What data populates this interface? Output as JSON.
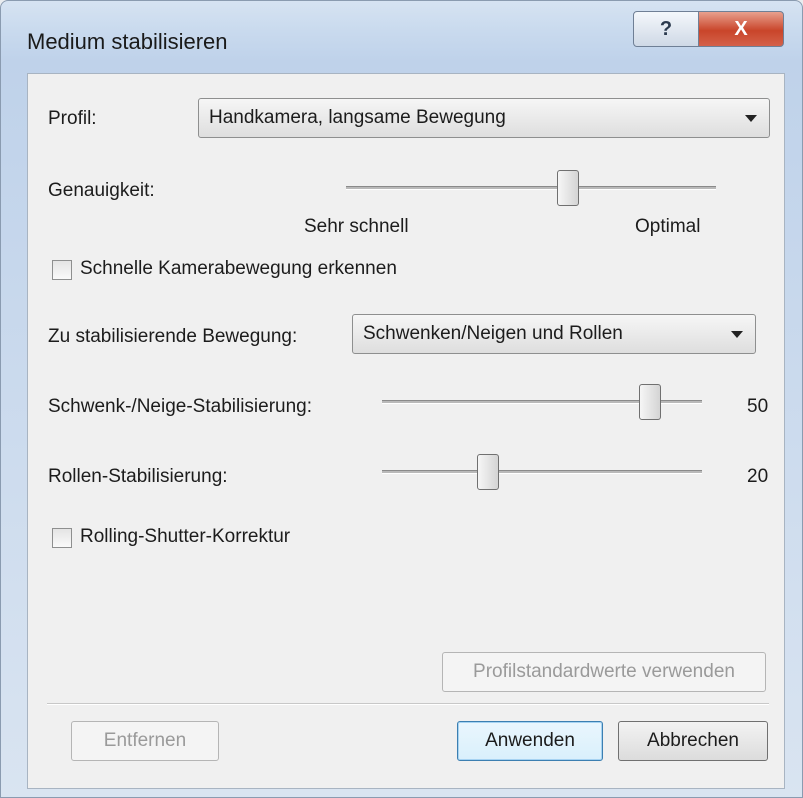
{
  "window": {
    "title": "Medium stabilisieren",
    "help_icon": "?",
    "close_icon": "X"
  },
  "profile": {
    "label": "Profil:",
    "value": "Handkamera, langsame Bewegung"
  },
  "accuracy": {
    "label": "Genauigkeit:",
    "min_label": "Sehr schnell",
    "max_label": "Optimal",
    "value_fraction": 0.6
  },
  "fast_camera": {
    "label": "Schnelle Kamerabewegung erkennen",
    "checked": false
  },
  "motion": {
    "label": "Zu stabilisierende Bewegung:",
    "value": "Schwenken/Neigen und Rollen"
  },
  "pan_tilt": {
    "label": "Schwenk-/Neige-Stabilisierung:",
    "value": "50"
  },
  "roll": {
    "label": "Rollen-Stabilisierung:",
    "value": "20"
  },
  "rolling_shutter": {
    "label": "Rolling-Shutter-Korrektur",
    "checked": false
  },
  "buttons": {
    "profile_defaults": "Profilstandardwerte verwenden",
    "remove": "Entfernen",
    "apply": "Anwenden",
    "cancel": "Abbrechen"
  }
}
